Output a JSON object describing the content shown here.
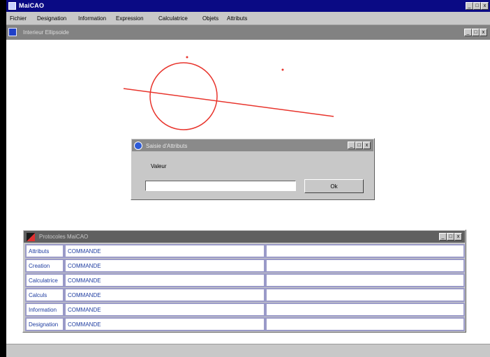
{
  "app": {
    "title": "MaiCAO",
    "window_buttons": [
      "_",
      "□",
      "x"
    ]
  },
  "menu": [
    "Fichier",
    "Designation",
    "Information",
    "Expression",
    "Calculatrice",
    "Objets",
    "Attributs"
  ],
  "child_window": {
    "title": "Interieur Ellipsoide"
  },
  "dialog": {
    "title": "Saisie d'Attributs",
    "label": "Valeur",
    "input_value": "",
    "ok_label": "Ok"
  },
  "panel": {
    "title": "Protocoles MaiCAO",
    "rows": [
      {
        "name": "Attributs",
        "command": "COMMANDE",
        "extra": ""
      },
      {
        "name": "Creation",
        "command": "COMMANDE",
        "extra": ""
      },
      {
        "name": "Calculatrice",
        "command": "COMMANDE",
        "extra": ""
      },
      {
        "name": "Calculs",
        "command": "COMMANDE",
        "extra": ""
      },
      {
        "name": "Information",
        "command": "COMMANDE",
        "extra": ""
      },
      {
        "name": "Designation",
        "command": "COMMANDE",
        "extra": ""
      }
    ]
  },
  "colors": {
    "title_active": "#0a0a84",
    "title_inactive": "#828282",
    "figure_stroke": "#e8342c",
    "grid_border": "#9a9ac8",
    "cell_text": "#1e3ca0"
  },
  "icons": [
    "app-icon",
    "child-window-icon",
    "dialog-icon",
    "panel-icon"
  ]
}
